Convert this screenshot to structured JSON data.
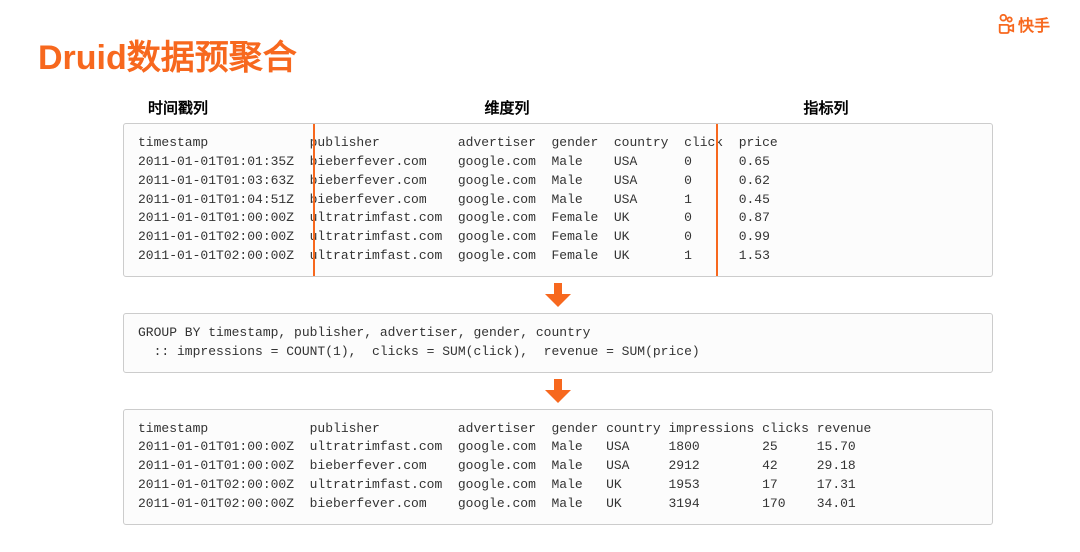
{
  "logo": {
    "text": "快手"
  },
  "title": "Druid数据预聚合",
  "labels": {
    "timestamp_col": "时间戳列",
    "dimension_col": "维度列",
    "metric_col": "指标列"
  },
  "table1": {
    "header": "timestamp             publisher          advertiser  gender  country  click  price",
    "rows": [
      "2011-01-01T01:01:35Z  bieberfever.com    google.com  Male    USA      0      0.65",
      "2011-01-01T01:03:63Z  bieberfever.com    google.com  Male    USA      0      0.62",
      "2011-01-01T01:04:51Z  bieberfever.com    google.com  Male    USA      1      0.45",
      "2011-01-01T01:00:00Z  ultratrimfast.com  google.com  Female  UK       0      0.87",
      "2011-01-01T02:00:00Z  ultratrimfast.com  google.com  Female  UK       0      0.99",
      "2011-01-01T02:00:00Z  ultratrimfast.com  google.com  Female  UK       1      1.53"
    ]
  },
  "groupby": {
    "line1": "GROUP BY timestamp, publisher, advertiser, gender, country",
    "line2": "  :: impressions = COUNT(1),  clicks = SUM(click),  revenue = SUM(price)"
  },
  "table2": {
    "header": "timestamp             publisher          advertiser  gender country impressions clicks revenue",
    "rows": [
      "2011-01-01T01:00:00Z  ultratrimfast.com  google.com  Male   USA     1800        25     15.70",
      "2011-01-01T01:00:00Z  bieberfever.com    google.com  Male   USA     2912        42     29.18",
      "2011-01-01T02:00:00Z  ultratrimfast.com  google.com  Male   UK      1953        17     17.31",
      "2011-01-01T02:00:00Z  bieberfever.com    google.com  Male   UK      3194        170    34.01"
    ]
  }
}
